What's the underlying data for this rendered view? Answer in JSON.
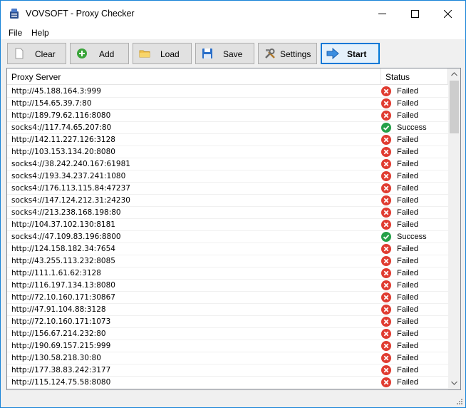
{
  "window": {
    "title": "VOVSOFT - Proxy Checker",
    "accent": "#0078d7"
  },
  "menu": {
    "file": "File",
    "help": "Help"
  },
  "toolbar": {
    "clear": "Clear",
    "add": "Add",
    "load": "Load",
    "save": "Save",
    "settings": "Settings",
    "start": "Start"
  },
  "table": {
    "columns": {
      "proxy": "Proxy Server",
      "status": "Status"
    },
    "rows": [
      {
        "proxy": "http://45.188.164.3:999",
        "status": "Failed"
      },
      {
        "proxy": "http://154.65.39.7:80",
        "status": "Failed"
      },
      {
        "proxy": "http://189.79.62.116:8080",
        "status": "Failed"
      },
      {
        "proxy": "socks4://117.74.65.207:80",
        "status": "Success"
      },
      {
        "proxy": "http://142.11.227.126:3128",
        "status": "Failed"
      },
      {
        "proxy": "http://103.153.134.20:8080",
        "status": "Failed"
      },
      {
        "proxy": "socks4://38.242.240.167:61981",
        "status": "Failed"
      },
      {
        "proxy": "socks4://193.34.237.241:1080",
        "status": "Failed"
      },
      {
        "proxy": "socks4://176.113.115.84:47237",
        "status": "Failed"
      },
      {
        "proxy": "socks4://147.124.212.31:24230",
        "status": "Failed"
      },
      {
        "proxy": "socks4://213.238.168.198:80",
        "status": "Failed"
      },
      {
        "proxy": "http://104.37.102.130:8181",
        "status": "Failed"
      },
      {
        "proxy": "socks4://47.109.83.196:8800",
        "status": "Success"
      },
      {
        "proxy": "http://124.158.182.34:7654",
        "status": "Failed"
      },
      {
        "proxy": "http://43.255.113.232:8085",
        "status": "Failed"
      },
      {
        "proxy": "http://111.1.61.62:3128",
        "status": "Failed"
      },
      {
        "proxy": "http://116.197.134.13:8080",
        "status": "Failed"
      },
      {
        "proxy": "http://72.10.160.171:30867",
        "status": "Failed"
      },
      {
        "proxy": "http://47.91.104.88:3128",
        "status": "Failed"
      },
      {
        "proxy": "http://72.10.160.171:1073",
        "status": "Failed"
      },
      {
        "proxy": "http://156.67.214.232:80",
        "status": "Failed"
      },
      {
        "proxy": "http://190.69.157.215:999",
        "status": "Failed"
      },
      {
        "proxy": "http://130.58.218.30:80",
        "status": "Failed"
      },
      {
        "proxy": "http://177.38.83.242:3177",
        "status": "Failed"
      },
      {
        "proxy": "http://115.124.75.58:8080",
        "status": "Failed"
      }
    ]
  },
  "status_colors": {
    "Failed": "#e03c31",
    "Success": "#24a048"
  }
}
